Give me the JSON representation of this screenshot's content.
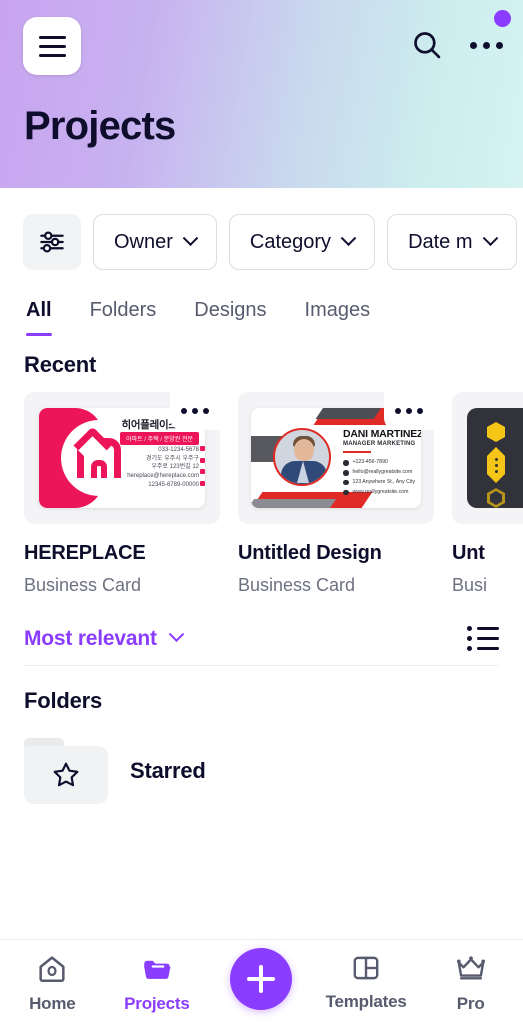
{
  "header": {
    "title": "Projects",
    "menu_icon": "hamburger-menu-icon",
    "search_icon": "search-icon",
    "more_icon": "more-horizontal-icon",
    "notification_dot_color": "#8b3dff",
    "gradient_from": "#c9a4f0",
    "gradient_to": "#d6f3f2"
  },
  "filters": {
    "sliders_icon": "filter-sliders-icon",
    "chips": [
      {
        "label": "Owner"
      },
      {
        "label": "Category"
      },
      {
        "label": "Date m"
      }
    ]
  },
  "tabs": [
    {
      "label": "All",
      "active": true
    },
    {
      "label": "Folders",
      "active": false
    },
    {
      "label": "Designs",
      "active": false
    },
    {
      "label": "Images",
      "active": false
    }
  ],
  "recent": {
    "heading": "Recent",
    "items": [
      {
        "title": "HEREPLACE",
        "subtitle": "Business Card",
        "thumb": {
          "style": "korean-realestate-card",
          "brand_name": "히어플레이스 사누",
          "tagline": "아파트 / 주택 / 분양권 전문",
          "phone": "033-1234-5678",
          "address_line1": "경기도 우주시 우주구",
          "address_line2": "우주로 123번길 12",
          "email": "hereplace@hereplace.com",
          "reg_number": "12345-6789-00000",
          "accent_color": "#ec1559"
        }
      },
      {
        "title": "Untitled Design",
        "subtitle": "Business Card",
        "thumb": {
          "style": "red-gray-portrait-card",
          "name": "DANI MARTINEZ",
          "role": "MANAGER MARKETING",
          "phone": "+123-456-7890",
          "email": "hello@reallygreatsite.com",
          "address": "123 Anywhere St., Any City",
          "website": "www.reallygreatsite.com",
          "accent_color": "#e02a26"
        }
      },
      {
        "title": "Unt",
        "subtitle": "Busi",
        "thumb": {
          "style": "dark-yellow-hexagon-card",
          "accent_color": "#f5c518",
          "background_color": "#32323a"
        }
      }
    ]
  },
  "sort": {
    "label": "Most relevant",
    "chevron_icon": "chevron-down-icon",
    "view_toggle_icon": "list-view-icon",
    "accent_color": "#8b3dff"
  },
  "folders": {
    "heading": "Folders",
    "items": [
      {
        "name": "Starred",
        "icon": "star-icon"
      }
    ]
  },
  "bottom_nav": {
    "items": [
      {
        "label": "Home",
        "icon": "home-icon",
        "active": false
      },
      {
        "label": "Projects",
        "icon": "folder-icon",
        "active": true
      },
      {
        "label": "Templates",
        "icon": "templates-grid-icon",
        "active": false
      },
      {
        "label": "Pro",
        "icon": "crown-icon",
        "active": false
      }
    ],
    "create_button": {
      "icon": "plus-icon",
      "color": "#8b3dff"
    }
  }
}
